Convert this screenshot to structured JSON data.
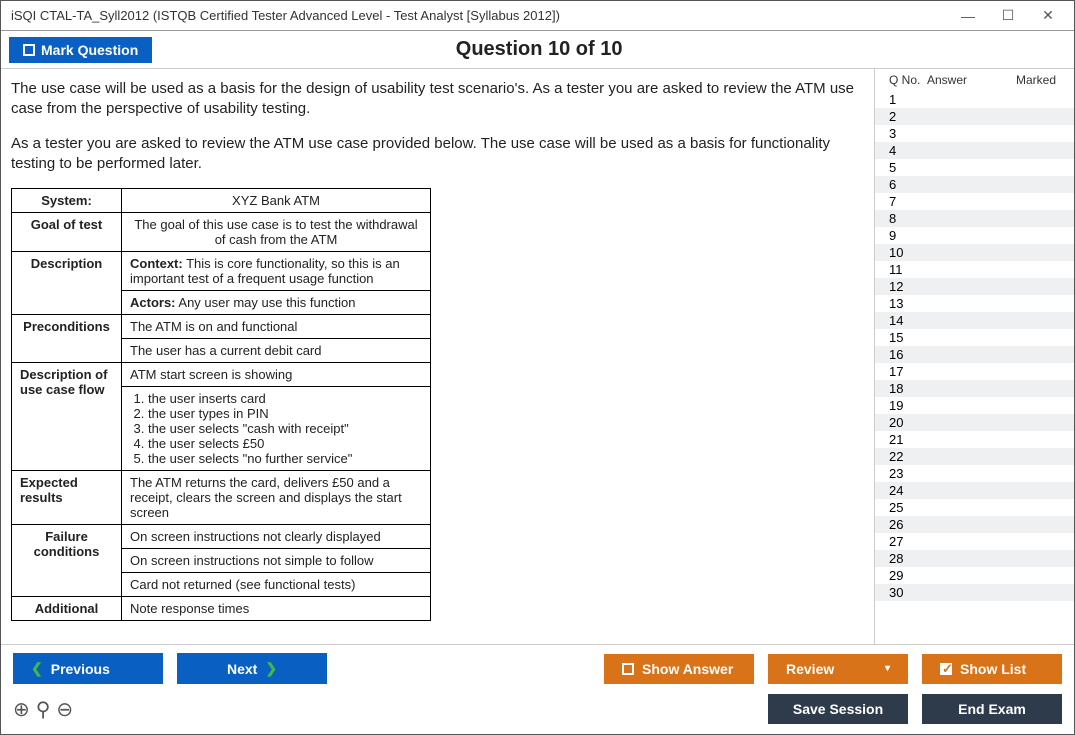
{
  "window": {
    "title": "iSQI CTAL-TA_Syll2012 (ISTQB Certified Tester Advanced Level - Test Analyst [Syllabus 2012])"
  },
  "header": {
    "mark_label": "Mark Question",
    "question_title": "Question 10 of 10"
  },
  "question": {
    "p1": "The use case will be used as a basis for the design of usability test scenario's. As a tester you are asked to review the ATM use case from the perspective of usability testing.",
    "p2": "As a tester you are asked to review the ATM use case provided below. The use case will be used as a basis for functionality testing to be performed later."
  },
  "usecase": {
    "system_lbl": "System:",
    "system_val": "XYZ Bank ATM",
    "goal_lbl": "Goal of test",
    "goal_val": "The goal of this use case is to test the withdrawal of cash from the ATM",
    "desc_lbl": "Description",
    "desc_ctx": "Context: This is core functionality, so this is an important test of a frequent usage function",
    "desc_actors": "Actors: Any user may use this function",
    "pre_lbl": "Preconditions",
    "pre1": "The ATM is on and functional",
    "pre2": "The user has a current debit card",
    "flow_lbl": "Description of use case flow",
    "flow_intro": "ATM start screen is showing",
    "flow_steps": [
      "the user inserts card",
      "the user types in PIN",
      "the user selects \"cash with receipt\"",
      "the user selects £50",
      "the user selects \"no further service\""
    ],
    "exp_lbl": "Expected results",
    "exp_val": "The ATM returns the card, delivers £50 and a receipt, clears the screen and displays the start screen",
    "fail_lbl": "Failure conditions",
    "fail1": "On screen instructions not clearly displayed",
    "fail2": "On screen instructions not simple to follow",
    "fail3": "Card not returned (see functional tests)",
    "add_lbl": "Additional",
    "add_val": "Note response times"
  },
  "nav": {
    "h_qno": "Q No.",
    "h_answer": "Answer",
    "h_marked": "Marked",
    "count": 30
  },
  "footer": {
    "previous": "Previous",
    "next": "Next",
    "show_answer": "Show Answer",
    "review": "Review",
    "show_list": "Show List",
    "save": "Save Session",
    "end": "End Exam"
  }
}
